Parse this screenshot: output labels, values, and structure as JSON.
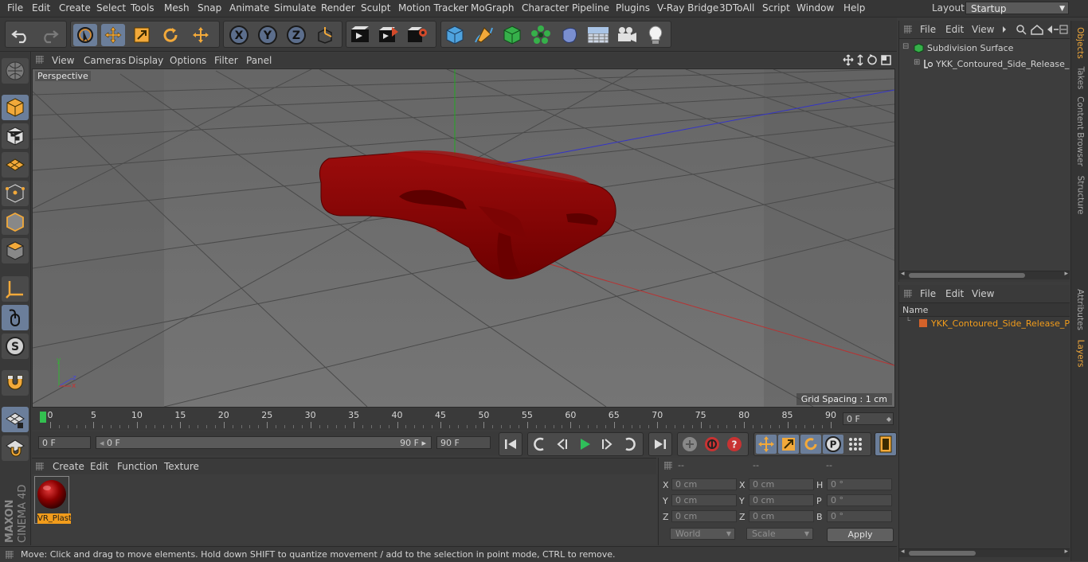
{
  "menu": {
    "items": [
      "File",
      "Edit",
      "Create",
      "Select",
      "Tools",
      "Mesh",
      "Snap",
      "Animate",
      "Simulate",
      "Render",
      "Sculpt",
      "Motion Tracker",
      "MoGraph",
      "Character",
      "Pipeline",
      "Plugins",
      "V-Ray Bridge",
      "3DToAll",
      "Script",
      "Window",
      "Help"
    ],
    "layout_label": "Layout:",
    "layout_value": "Startup"
  },
  "toolbar": {
    "icons": [
      "undo-icon",
      "redo-icon",
      "live-selection-icon",
      "move-icon",
      "scale-icon",
      "rotate-icon",
      "add-tool-icon",
      "x-axis-icon",
      "y-axis-icon",
      "z-axis-icon",
      "world-coords-icon",
      "render-view-icon",
      "render-picture-viewer-icon",
      "render-settings-icon",
      "cube-icon",
      "pen-spline-icon",
      "subdivision-nurbs-icon",
      "cloner-icon",
      "deformer-icon",
      "floor-icon",
      "camera-icon",
      "light-icon"
    ],
    "axis_labels": {
      "x": "X",
      "y": "Y",
      "z": "Z"
    }
  },
  "left_tools": [
    "make-editable",
    "model-mode",
    "texture-mode",
    "workplane-mode",
    "points-mode",
    "edges-mode",
    "polygons-mode",
    "enable-axis",
    "tweak-mode",
    "solo-mode",
    "magnet",
    "snap-settings",
    "snap-toggle"
  ],
  "viewport": {
    "menu": [
      "View",
      "Cameras",
      "Display",
      "Options",
      "Filter",
      "Panel"
    ],
    "label": "Perspective",
    "grid_spacing": "Grid Spacing : 1 cm",
    "axis_labels": {
      "x": "x",
      "y": "y",
      "z": "z"
    }
  },
  "timeline": {
    "ticks": [
      "0",
      "5",
      "10",
      "15",
      "20",
      "25",
      "30",
      "35",
      "40",
      "45",
      "50",
      "55",
      "60",
      "65",
      "70",
      "75",
      "80",
      "85",
      "90"
    ],
    "current_frame": "0 F"
  },
  "transport": {
    "start_field": "0 F",
    "range_start": "0 F",
    "range_end": "90 F",
    "end_field": "90 F"
  },
  "material_manager": {
    "menu": [
      "Create",
      "Edit",
      "Function",
      "Texture"
    ],
    "materials": [
      {
        "name": "VR_Plast",
        "color": "#8b0000"
      }
    ]
  },
  "coordinates": {
    "headers": [
      "--",
      "--",
      "--"
    ],
    "rows": [
      {
        "l1": "X",
        "v1": "0 cm",
        "l2": "X",
        "v2": "0 cm",
        "l3": "H",
        "v3": "0 °"
      },
      {
        "l1": "Y",
        "v1": "0 cm",
        "l2": "Y",
        "v2": "0 cm",
        "l3": "P",
        "v3": "0 °"
      },
      {
        "l1": "Z",
        "v1": "0 cm",
        "l2": "Z",
        "v2": "0 cm",
        "l3": "B",
        "v3": "0 °"
      }
    ],
    "mode1": "World",
    "mode2": "Scale",
    "apply": "Apply"
  },
  "status": "Move: Click and drag to move elements. Hold down SHIFT to quantize movement / add to the selection in point mode, CTRL to remove.",
  "brand": {
    "line1": "MAXON",
    "line2": "CINEMA 4D"
  },
  "objects_panel": {
    "menu": [
      "File",
      "Edit",
      "View"
    ],
    "items": [
      {
        "name": "Subdivision Surface",
        "indent": 0,
        "color": "#c8c8c8"
      },
      {
        "name": "YKK_Contoured_Side_Release_Plastic_Buckle",
        "indent": 1,
        "color": "#c8c8c8"
      }
    ]
  },
  "layers_panel": {
    "menu": [
      "File",
      "Edit",
      "View"
    ],
    "column": "Name",
    "items": [
      {
        "name": "YKK_Contoured_Side_Release_Plastic_Buckle",
        "color": "#f29c1b",
        "swatch": "#d4622a"
      }
    ]
  },
  "side_tabs": [
    {
      "label": "Objects",
      "active": true
    },
    {
      "label": "Takes",
      "active": false
    },
    {
      "label": "Content Browser",
      "active": false
    },
    {
      "label": "Structure",
      "active": false
    },
    {
      "label": "Attributes",
      "active": false
    },
    {
      "label": "Layers",
      "active": true
    }
  ],
  "colors": {
    "accent": "#f29c1b",
    "object": "#8b0000",
    "axis_x": "#c83232",
    "axis_y": "#32b432",
    "axis_z": "#3c3cdc"
  }
}
